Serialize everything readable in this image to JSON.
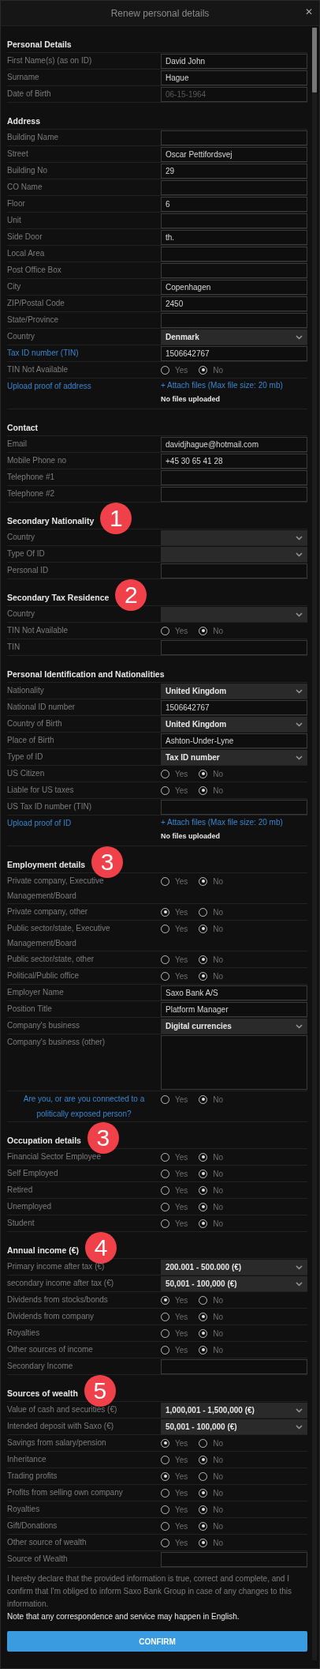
{
  "window": {
    "title": "Renew personal details",
    "close": "✕"
  },
  "sections": [
    {
      "title": "Personal Details",
      "rows": [
        {
          "kind": "text",
          "label": "First Name(s) (as on ID)",
          "value": "David John"
        },
        {
          "kind": "text",
          "label": "Surname",
          "value": "Hague"
        },
        {
          "kind": "text",
          "label": "Date of Birth",
          "value": "06-15-1964",
          "disabled": true
        }
      ]
    },
    {
      "title": "Address",
      "rows": [
        {
          "kind": "text",
          "label": "Building Name"
        },
        {
          "kind": "text",
          "label": "Street",
          "value": "Oscar Pettifordsvej"
        },
        {
          "kind": "text",
          "label": "Building No",
          "value": "29"
        },
        {
          "kind": "text",
          "label": "CO Name"
        },
        {
          "kind": "text",
          "label": "Floor",
          "value": "6"
        },
        {
          "kind": "text",
          "label": "Unit"
        },
        {
          "kind": "text",
          "label": "Side Door",
          "value": "th."
        },
        {
          "kind": "text",
          "label": "Local Area"
        },
        {
          "kind": "text",
          "label": "Post Office Box"
        },
        {
          "kind": "text",
          "label": "City",
          "value": "Copenhagen"
        },
        {
          "kind": "text",
          "label": "ZIP/Postal Code",
          "value": "2450"
        },
        {
          "kind": "text",
          "label": "State/Province"
        },
        {
          "kind": "select",
          "label": "Country",
          "value": "Denmark"
        },
        {
          "kind": "text",
          "label": "Tax ID number (TIN)",
          "value": "1506642767",
          "link": true
        },
        {
          "kind": "radio",
          "label": "TIN Not Available",
          "options": [
            {
              "label": "Yes",
              "selected": false
            },
            {
              "label": "No",
              "selected": true
            }
          ]
        },
        {
          "kind": "upload",
          "label": "Upload proof of address",
          "attach": "+ Attach files (Max file size: 20 mb)",
          "status": "No files uploaded"
        }
      ]
    },
    {
      "title": "Contact",
      "rows": [
        {
          "kind": "text",
          "label": "Email",
          "value": "davidjhague@hotmail.com"
        },
        {
          "kind": "text",
          "label": "Mobile Phone no",
          "value": "+45 30 65 41 28"
        },
        {
          "kind": "text",
          "label": "Telephone #1"
        },
        {
          "kind": "text",
          "label": "Telephone #2"
        }
      ]
    },
    {
      "title": "Secondary Nationality",
      "badge": "1",
      "rows": [
        {
          "kind": "select",
          "label": "Country"
        },
        {
          "kind": "select",
          "label": "Type Of ID"
        },
        {
          "kind": "text",
          "label": "Personal ID"
        }
      ]
    },
    {
      "title": "Secondary Tax Residence",
      "badge": "2",
      "rows": [
        {
          "kind": "select",
          "label": "Country"
        },
        {
          "kind": "radio",
          "label": "TIN Not Available",
          "options": [
            {
              "label": "Yes",
              "selected": false
            },
            {
              "label": "No",
              "selected": true
            }
          ]
        },
        {
          "kind": "text",
          "label": "TIN"
        }
      ]
    },
    {
      "title": "Personal Identification and Nationalities",
      "rows": [
        {
          "kind": "select",
          "label": "Nationality",
          "value": "United Kingdom"
        },
        {
          "kind": "text",
          "label": "National ID number",
          "value": "1506642767"
        },
        {
          "kind": "select",
          "label": "Country of Birth",
          "value": "United Kingdom"
        },
        {
          "kind": "text",
          "label": "Place of Birth",
          "value": "Ashton-Under-Lyne"
        },
        {
          "kind": "select",
          "label": "Type of ID",
          "value": "Tax ID number"
        },
        {
          "kind": "radio",
          "label": "US Citizen",
          "options": [
            {
              "label": "Yes",
              "selected": false
            },
            {
              "label": "No",
              "selected": true
            }
          ]
        },
        {
          "kind": "radio",
          "label": "Liable for US taxes",
          "options": [
            {
              "label": "Yes",
              "selected": false
            },
            {
              "label": "No",
              "selected": true
            }
          ]
        },
        {
          "kind": "text",
          "label": "US Tax ID number (TIN)"
        },
        {
          "kind": "upload",
          "label": "Upload proof of ID",
          "attach": "+ Attach files (Max file size: 20 mb)",
          "status": "No files uploaded"
        }
      ]
    },
    {
      "title": "Employment details",
      "badge": "3",
      "rows": [
        {
          "kind": "radio",
          "label": "Private company, Executive Management/Board",
          "options": [
            {
              "label": "Yes",
              "selected": false
            },
            {
              "label": "No",
              "selected": true
            }
          ]
        },
        {
          "kind": "radio",
          "label": "Private company, other",
          "options": [
            {
              "label": "Yes",
              "selected": true
            },
            {
              "label": "No",
              "selected": false
            }
          ]
        },
        {
          "kind": "radio",
          "label": "Public sector/state, Executive Management/Board",
          "options": [
            {
              "label": "Yes",
              "selected": false
            },
            {
              "label": "No",
              "selected": true
            }
          ]
        },
        {
          "kind": "radio",
          "label": "Public sector/state, other",
          "options": [
            {
              "label": "Yes",
              "selected": false
            },
            {
              "label": "No",
              "selected": true
            }
          ]
        },
        {
          "kind": "radio",
          "label": "Political/Public office",
          "options": [
            {
              "label": "Yes",
              "selected": false
            },
            {
              "label": "No",
              "selected": true
            }
          ]
        },
        {
          "kind": "text",
          "label": "Employer Name",
          "value": "Saxo Bank A/S"
        },
        {
          "kind": "text",
          "label": "Position Title",
          "value": "Platform Manager"
        },
        {
          "kind": "select",
          "label": "Company's business",
          "value": "Digital currencies"
        },
        {
          "kind": "textarea",
          "label": "Company's business (other)"
        },
        {
          "kind": "radio",
          "label": "Are you, or are you connected to a politically exposed person?",
          "link": true,
          "options": [
            {
              "label": "Yes",
              "selected": false
            },
            {
              "label": "No",
              "selected": true
            }
          ]
        }
      ]
    },
    {
      "title": "Occupation details",
      "badge": "3",
      "rows": [
        {
          "kind": "radio",
          "label": "Financial Sector Employee",
          "options": [
            {
              "label": "Yes",
              "selected": false
            },
            {
              "label": "No",
              "selected": true
            }
          ]
        },
        {
          "kind": "radio",
          "label": "Self Employed",
          "options": [
            {
              "label": "Yes",
              "selected": false
            },
            {
              "label": "No",
              "selected": true
            }
          ]
        },
        {
          "kind": "radio",
          "label": "Retired",
          "options": [
            {
              "label": "Yes",
              "selected": false
            },
            {
              "label": "No",
              "selected": true
            }
          ]
        },
        {
          "kind": "radio",
          "label": "Unemployed",
          "options": [
            {
              "label": "Yes",
              "selected": false
            },
            {
              "label": "No",
              "selected": true
            }
          ]
        },
        {
          "kind": "radio",
          "label": "Student",
          "options": [
            {
              "label": "Yes",
              "selected": false
            },
            {
              "label": "No",
              "selected": true
            }
          ]
        }
      ]
    },
    {
      "title": "Annual income (€)",
      "badge": "4",
      "rows": [
        {
          "kind": "select",
          "label": "Primary income after tax (€)",
          "value": "200.001 - 500.000 (€)"
        },
        {
          "kind": "select",
          "label": "secondary income after tax (€)",
          "value": "50,001 - 100,000 (€)"
        },
        {
          "kind": "radio",
          "label": "Dividends from stocks/bonds",
          "options": [
            {
              "label": "Yes",
              "selected": true
            },
            {
              "label": "No",
              "selected": false
            }
          ]
        },
        {
          "kind": "radio",
          "label": "Dividends from company",
          "options": [
            {
              "label": "Yes",
              "selected": false
            },
            {
              "label": "No",
              "selected": true
            }
          ]
        },
        {
          "kind": "radio",
          "label": "Royalties",
          "options": [
            {
              "label": "Yes",
              "selected": false
            },
            {
              "label": "No",
              "selected": true
            }
          ]
        },
        {
          "kind": "radio",
          "label": "Other sources of income",
          "options": [
            {
              "label": "Yes",
              "selected": false
            },
            {
              "label": "No",
              "selected": true
            }
          ]
        },
        {
          "kind": "text",
          "label": "Secondary Income"
        }
      ]
    },
    {
      "title": "Sources of wealth",
      "badge": "5",
      "rows": [
        {
          "kind": "select",
          "label": "Value of cash and securities (€)",
          "value": "1,000,001 - 1,500,000 (€)"
        },
        {
          "kind": "select",
          "label": "Intended deposit with Saxo (€)",
          "value": "50,001 - 100,000 (€)"
        },
        {
          "kind": "radio",
          "label": "Savings from salary/pension",
          "options": [
            {
              "label": "Yes",
              "selected": true
            },
            {
              "label": "No",
              "selected": false
            }
          ]
        },
        {
          "kind": "radio",
          "label": "Inheritance",
          "options": [
            {
              "label": "Yes",
              "selected": false
            },
            {
              "label": "No",
              "selected": true
            }
          ]
        },
        {
          "kind": "radio",
          "label": "Trading profits",
          "options": [
            {
              "label": "Yes",
              "selected": true
            },
            {
              "label": "No",
              "selected": false
            }
          ]
        },
        {
          "kind": "radio",
          "label": "Profits from selling own company",
          "options": [
            {
              "label": "Yes",
              "selected": false
            },
            {
              "label": "No",
              "selected": true
            }
          ]
        },
        {
          "kind": "radio",
          "label": "Royalties",
          "options": [
            {
              "label": "Yes",
              "selected": false
            },
            {
              "label": "No",
              "selected": true
            }
          ]
        },
        {
          "kind": "radio",
          "label": "Gift/Donations",
          "options": [
            {
              "label": "Yes",
              "selected": false
            },
            {
              "label": "No",
              "selected": true
            }
          ]
        },
        {
          "kind": "radio",
          "label": "Other source of wealth",
          "options": [
            {
              "label": "Yes",
              "selected": false
            },
            {
              "label": "No",
              "selected": true
            }
          ]
        },
        {
          "kind": "text",
          "label": "Source of Wealth"
        }
      ]
    }
  ],
  "declaration": {
    "text": "I hereby declare that the provided information is true, correct and complete, and I confirm that I'm obliged to inform Saxo Bank Group in case of any changes to this information.",
    "note": "Note that any correspondence and service may happen in English."
  },
  "confirm_button": "CONFIRM"
}
